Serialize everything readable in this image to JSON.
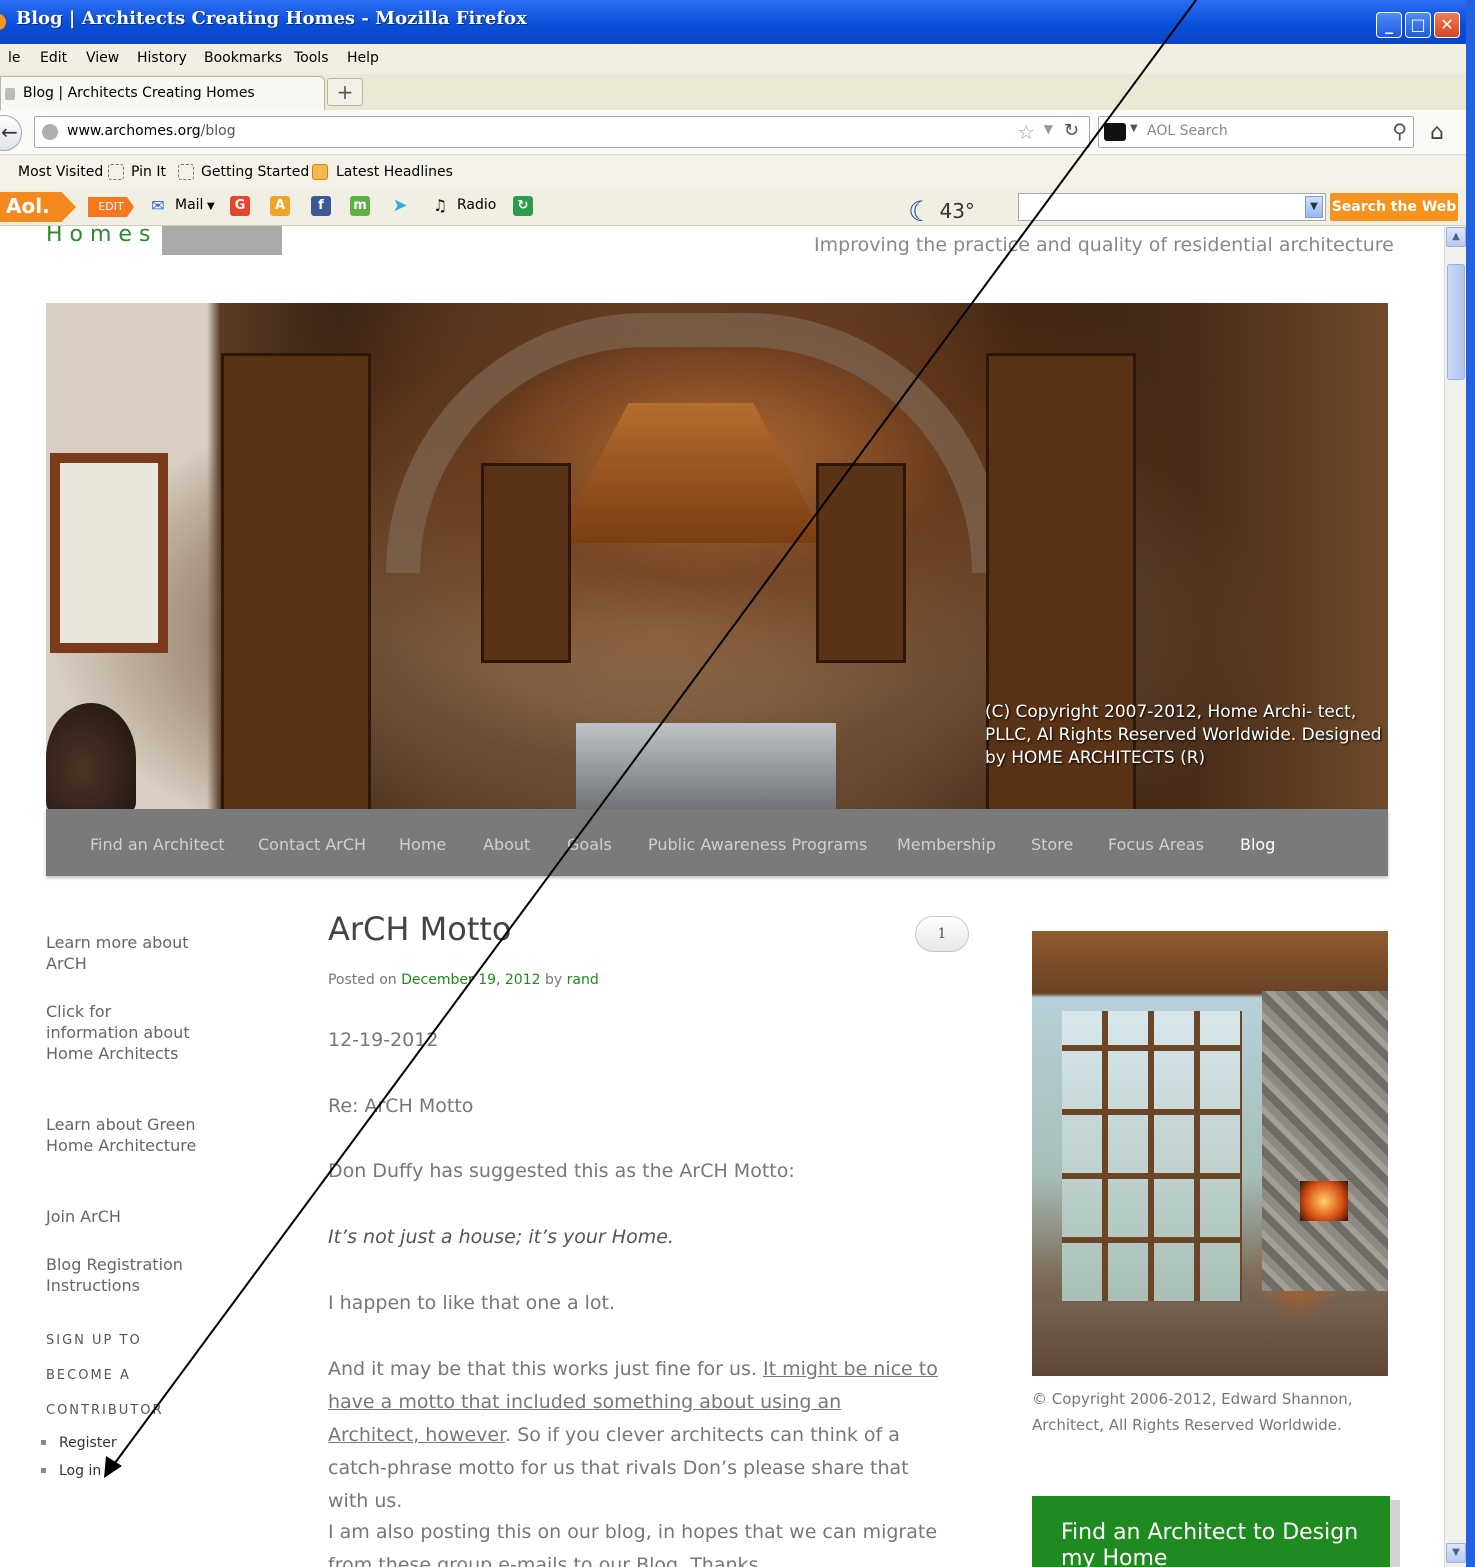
{
  "window": {
    "title": "Blog | Architects Creating Homes - Mozilla Firefox",
    "controls": {
      "minimize": "_",
      "maximize": "□",
      "close": "✕"
    }
  },
  "menubar": {
    "items": [
      "le",
      "Edit",
      "View",
      "History",
      "Bookmarks",
      "Tools",
      "Help"
    ]
  },
  "tabs": {
    "active_label": "Blog | Architects Creating Homes",
    "new_tab": "+"
  },
  "navbar": {
    "back_glyph": "←",
    "url_host": "www.archomes.org",
    "url_path": "/blog",
    "search_placeholder": "AOL Search"
  },
  "bookmarks": {
    "items": [
      "Most Visited",
      "Pin It",
      "Getting Started",
      "Latest Headlines"
    ]
  },
  "aol_toolbar": {
    "logo": "Aol.",
    "edit": "EDIT",
    "mail": "Mail",
    "radio": "Radio",
    "temperature": "43°",
    "search_button": "Search the Web"
  },
  "site": {
    "logo_text": "Homes",
    "tagline": "Improving the practice and quality of residential architecture",
    "hero_copyright": "(C) Copyright 2007-2012, Home Archi- tect, PLLC, Al Rights Reserved Worldwide. Designed by HOME ARCHITECTS (R)",
    "nav": [
      {
        "label": "Find an Architect"
      },
      {
        "label": "Contact ArCH"
      },
      {
        "label": "Home"
      },
      {
        "label": "About"
      },
      {
        "label": "Goals"
      },
      {
        "label": "Public Awareness Programs"
      },
      {
        "label": "Membership"
      },
      {
        "label": "Store"
      },
      {
        "label": "Focus Areas"
      },
      {
        "label": "Blog",
        "active": true
      }
    ]
  },
  "sidebar": {
    "links": [
      "Learn more about ArCH",
      "Click for information about Home Architects",
      "Learn about Green Home Architecture",
      "Join ArCH",
      "Blog Registration Instructions"
    ],
    "signup_heading": [
      "SIGN UP TO",
      "BECOME A",
      "CONTRIBUTOR"
    ],
    "meta": [
      "Register",
      "Log in"
    ]
  },
  "post": {
    "title": "ArCH Motto",
    "comment_count": "1",
    "posted_on_label": "Posted on",
    "date": "December 19, 2012",
    "by_label": "by",
    "author": "rand",
    "date_line": "12-19-2012",
    "re_line": "Re: ArCH Motto",
    "p1": "Don Duffy has suggested this as the ArCH Motto:",
    "motto": "It’s not just a house; it’s your Home.",
    "p2": "I happen to like that one a lot.",
    "p3_start": "And it may be that this works just fine for us.",
    "p3_link": "It might be nice to have a motto that included something about using an Architect, however",
    "p3_end": ". So if you clever architects can think of a catch-phrase motto for us that rivals Don’s please share that with us.",
    "p4": "I am also posting this on our blog, in hopes that we can migrate from these group e-mails to our Blog. Thanks."
  },
  "right_column": {
    "photo_caption": "© Copyright 2006-2012, Edward Shannon, Architect, All Rights Reserved Worldwide.",
    "cta": "Find an Architect to Design my Home"
  },
  "icons": [
    "firefox-icon",
    "back-icon",
    "globe-icon",
    "star-icon",
    "reload-icon",
    "magnifier-icon",
    "home-icon",
    "rss-icon",
    "mail-icon",
    "twitter-icon",
    "headphones-icon",
    "moon-icon"
  ],
  "colors": {
    "accent_green": "#1f8a1f",
    "nav_grey": "#7a7a7a",
    "aol_orange": "#f6921e",
    "titlebar_blue": "#0a4fd8"
  }
}
